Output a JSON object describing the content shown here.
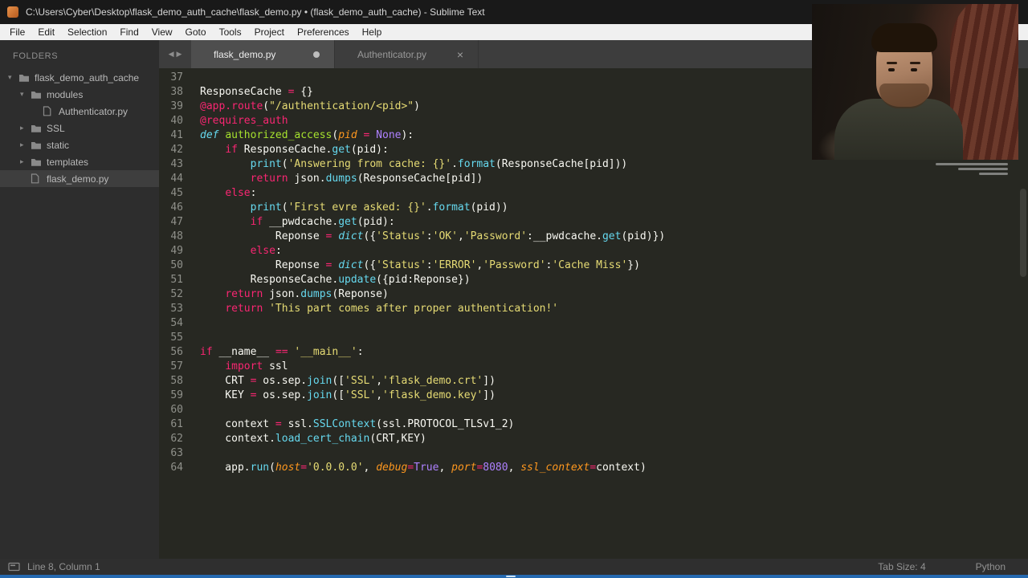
{
  "title_bar": {
    "title": "C:\\Users\\Cyber\\Desktop\\flask_demo_auth_cache\\flask_demo.py • (flask_demo_auth_cache) - Sublime Text"
  },
  "menu": {
    "items": [
      "File",
      "Edit",
      "Selection",
      "Find",
      "View",
      "Goto",
      "Tools",
      "Project",
      "Preferences",
      "Help"
    ]
  },
  "sidebar": {
    "header": "FOLDERS",
    "tree": [
      {
        "label": "flask_demo_auth_cache",
        "type": "folder",
        "depth": 0,
        "expanded": true,
        "selected": false
      },
      {
        "label": "modules",
        "type": "folder",
        "depth": 1,
        "expanded": true,
        "selected": false
      },
      {
        "label": "Authenticator.py",
        "type": "file",
        "depth": 2,
        "selected": false
      },
      {
        "label": "SSL",
        "type": "folder",
        "depth": 1,
        "expanded": false,
        "selected": false
      },
      {
        "label": "static",
        "type": "folder",
        "depth": 1,
        "expanded": false,
        "selected": false
      },
      {
        "label": "templates",
        "type": "folder",
        "depth": 1,
        "expanded": false,
        "selected": false
      },
      {
        "label": "flask_demo.py",
        "type": "file",
        "depth": 1,
        "selected": true
      }
    ]
  },
  "tab_bar": {
    "scroll_left": "◀",
    "scroll_right": "▶",
    "tabs": [
      {
        "label": "flask_demo.py",
        "active": true,
        "modified": true
      },
      {
        "label": "Authenticator.py",
        "active": false,
        "modified": false,
        "close_glyph": "×"
      }
    ]
  },
  "editor": {
    "first_line_number": 37,
    "lines": [
      [],
      [
        [
          "w",
          "ResponseCache "
        ],
        [
          "p",
          "="
        ],
        [
          "w",
          " {}"
        ]
      ],
      [
        [
          "p",
          "@app.route"
        ],
        [
          "w",
          "("
        ],
        [
          "y",
          "\"/authentication/<pid>\""
        ],
        [
          "w",
          ")"
        ]
      ],
      [
        [
          "p",
          "@requires_auth"
        ]
      ],
      [
        [
          "ci",
          "def "
        ],
        [
          "g",
          "authorized_access"
        ],
        [
          "w",
          "("
        ],
        [
          "o",
          "pid "
        ],
        [
          "p",
          "="
        ],
        [
          "w",
          " "
        ],
        [
          "u",
          "None"
        ],
        [
          "w",
          "):"
        ]
      ],
      [
        [
          "w",
          "    "
        ],
        [
          "p",
          "if"
        ],
        [
          "w",
          " ResponseCache."
        ],
        [
          "c",
          "get"
        ],
        [
          "w",
          "(pid):"
        ]
      ],
      [
        [
          "w",
          "        "
        ],
        [
          "c",
          "print"
        ],
        [
          "w",
          "("
        ],
        [
          "y",
          "'Answering from cache: {}'"
        ],
        [
          "w",
          "."
        ],
        [
          "c",
          "format"
        ],
        [
          "w",
          "(ResponseCache[pid]))"
        ]
      ],
      [
        [
          "w",
          "        "
        ],
        [
          "p",
          "return"
        ],
        [
          "w",
          " json."
        ],
        [
          "c",
          "dumps"
        ],
        [
          "w",
          "(ResponseCache[pid])"
        ]
      ],
      [
        [
          "w",
          "    "
        ],
        [
          "p",
          "else"
        ],
        [
          "w",
          ":"
        ]
      ],
      [
        [
          "w",
          "        "
        ],
        [
          "c",
          "print"
        ],
        [
          "w",
          "("
        ],
        [
          "y",
          "'First evre asked: {}'"
        ],
        [
          "w",
          "."
        ],
        [
          "c",
          "format"
        ],
        [
          "w",
          "(pid))"
        ]
      ],
      [
        [
          "w",
          "        "
        ],
        [
          "p",
          "if"
        ],
        [
          "w",
          " __pwdcache."
        ],
        [
          "c",
          "get"
        ],
        [
          "w",
          "(pid):"
        ]
      ],
      [
        [
          "w",
          "            Reponse "
        ],
        [
          "p",
          "="
        ],
        [
          "w",
          " "
        ],
        [
          "ci",
          "dict"
        ],
        [
          "w",
          "({"
        ],
        [
          "y",
          "'Status'"
        ],
        [
          "w",
          ":"
        ],
        [
          "y",
          "'OK'"
        ],
        [
          "w",
          ","
        ],
        [
          "y",
          "'Password'"
        ],
        [
          "w",
          ":__pwdcache."
        ],
        [
          "c",
          "get"
        ],
        [
          "w",
          "(pid)})"
        ]
      ],
      [
        [
          "w",
          "        "
        ],
        [
          "p",
          "else"
        ],
        [
          "w",
          ":"
        ]
      ],
      [
        [
          "w",
          "            Reponse "
        ],
        [
          "p",
          "="
        ],
        [
          "w",
          " "
        ],
        [
          "ci",
          "dict"
        ],
        [
          "w",
          "({"
        ],
        [
          "y",
          "'Status'"
        ],
        [
          "w",
          ":"
        ],
        [
          "y",
          "'ERROR'"
        ],
        [
          "w",
          ","
        ],
        [
          "y",
          "'Password'"
        ],
        [
          "w",
          ":"
        ],
        [
          "y",
          "'Cache Miss'"
        ],
        [
          "w",
          "})"
        ]
      ],
      [
        [
          "w",
          "        ResponseCache."
        ],
        [
          "c",
          "update"
        ],
        [
          "w",
          "({pid:Reponse})"
        ]
      ],
      [
        [
          "w",
          "    "
        ],
        [
          "p",
          "return"
        ],
        [
          "w",
          " json."
        ],
        [
          "c",
          "dumps"
        ],
        [
          "w",
          "(Reponse)"
        ]
      ],
      [
        [
          "w",
          "    "
        ],
        [
          "p",
          "return"
        ],
        [
          "w",
          " "
        ],
        [
          "y",
          "'This part comes after proper authentication!'"
        ]
      ],
      [],
      [],
      [
        [
          "p",
          "if"
        ],
        [
          "w",
          " __name__ "
        ],
        [
          "p",
          "=="
        ],
        [
          "w",
          " "
        ],
        [
          "y",
          "'__main__'"
        ],
        [
          "w",
          ":"
        ]
      ],
      [
        [
          "w",
          "    "
        ],
        [
          "p",
          "import"
        ],
        [
          "w",
          " ssl"
        ]
      ],
      [
        [
          "w",
          "    CRT "
        ],
        [
          "p",
          "="
        ],
        [
          "w",
          " os.sep."
        ],
        [
          "c",
          "join"
        ],
        [
          "w",
          "(["
        ],
        [
          "y",
          "'SSL'"
        ],
        [
          "w",
          ","
        ],
        [
          "y",
          "'flask_demo.crt'"
        ],
        [
          "w",
          "])"
        ]
      ],
      [
        [
          "w",
          "    KEY "
        ],
        [
          "p",
          "="
        ],
        [
          "w",
          " os.sep."
        ],
        [
          "c",
          "join"
        ],
        [
          "w",
          "(["
        ],
        [
          "y",
          "'SSL'"
        ],
        [
          "w",
          ","
        ],
        [
          "y",
          "'flask_demo.key'"
        ],
        [
          "w",
          "])"
        ]
      ],
      [],
      [
        [
          "w",
          "    context "
        ],
        [
          "p",
          "="
        ],
        [
          "w",
          " ssl."
        ],
        [
          "c",
          "SSLContext"
        ],
        [
          "w",
          "(ssl.PROTOCOL_TLSv1_2)"
        ]
      ],
      [
        [
          "w",
          "    context."
        ],
        [
          "c",
          "load_cert_chain"
        ],
        [
          "w",
          "(CRT,KEY)"
        ]
      ],
      [],
      [
        [
          "w",
          "    app."
        ],
        [
          "c",
          "run"
        ],
        [
          "w",
          "("
        ],
        [
          "o",
          "host"
        ],
        [
          "p",
          "="
        ],
        [
          "y",
          "'0.0.0.0'"
        ],
        [
          "w",
          ", "
        ],
        [
          "o",
          "debug"
        ],
        [
          "p",
          "="
        ],
        [
          "u",
          "True"
        ],
        [
          "w",
          ", "
        ],
        [
          "o",
          "port"
        ],
        [
          "p",
          "="
        ],
        [
          "u",
          "8080"
        ],
        [
          "w",
          ", "
        ],
        [
          "o",
          "ssl_context"
        ],
        [
          "p",
          "="
        ],
        [
          "w",
          "context)"
        ]
      ]
    ]
  },
  "status_bar": {
    "line_col": "Line 8, Column 1",
    "tab_size": "Tab Size: 4",
    "syntax": "Python"
  },
  "colors": {
    "editor_bg": "#272822",
    "keyword": "#f92672",
    "string": "#e6db74",
    "function_name": "#a6e22e",
    "support_call": "#66d9ef",
    "parameter": "#fd971f",
    "constant": "#ae81ff",
    "text": "#f8f8f2",
    "line_number": "#8f908a",
    "sidebar_bg": "#2d2d2d",
    "taskbar_strip": "#2569b0"
  }
}
